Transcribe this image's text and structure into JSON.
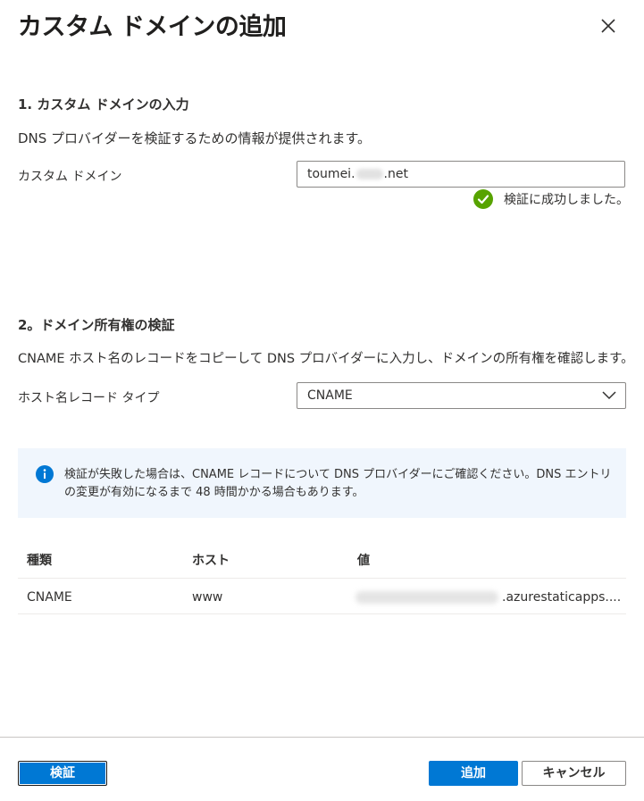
{
  "dialog": {
    "title": "カスタム ドメインの追加",
    "close_label": "×"
  },
  "section1": {
    "heading": "1. カスタム ドメインの入力",
    "description": "DNS プロバイダーを検証するための情報が提供されます。",
    "domain_label": "カスタム ドメイン",
    "domain_value_prefix": "toumei.",
    "domain_value_suffix": ".net",
    "success_message": "検証に成功しました。",
    "success_color": "#57a300"
  },
  "section2": {
    "heading": "2。ドメイン所有権の検証",
    "description": "CNAME ホスト名のレコードをコピーして DNS プロバイダーに入力し、ドメインの所有権を確認します。",
    "record_type_label": "ホスト名レコード タイプ",
    "record_type_value": "CNAME"
  },
  "info": {
    "message": "検証が失敗した場合は、CNAME レコードについて DNS プロバイダーにご確認ください。DNS エントリの変更が有効になるまで 48 時間かかる場合もあります。",
    "icon_color": "#0078d4"
  },
  "table": {
    "headers": [
      "種類",
      "ホスト",
      "値"
    ],
    "rows": [
      {
        "type": "CNAME",
        "host": "www",
        "value_suffix": ".azurestaticapps...."
      }
    ]
  },
  "footer": {
    "verify_label": "検証",
    "add_label": "追加",
    "cancel_label": "キャンセル",
    "accent_color": "#0078d4"
  }
}
